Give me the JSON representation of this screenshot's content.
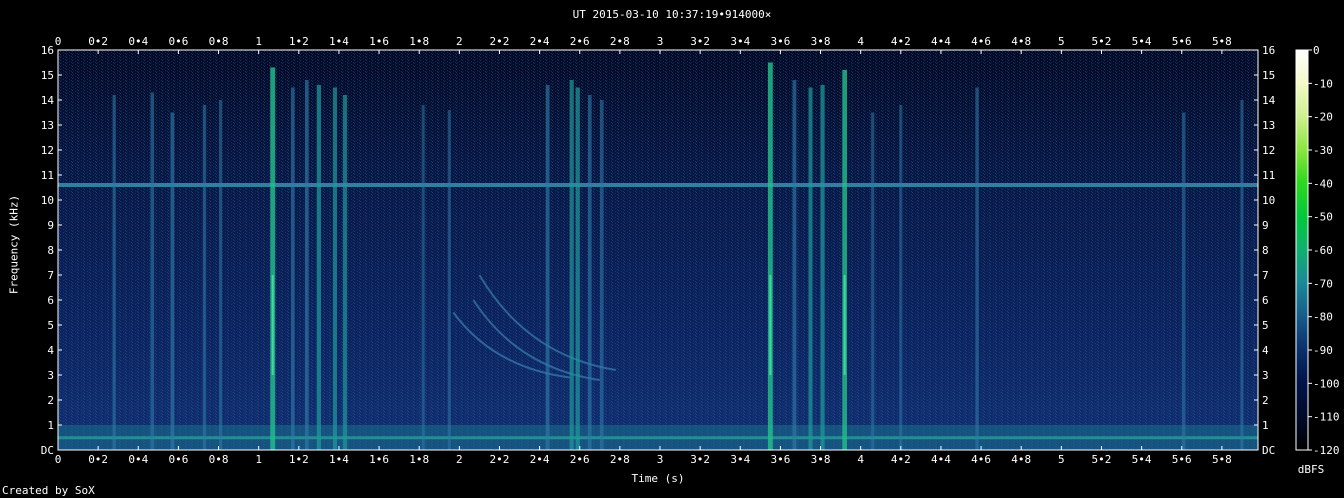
{
  "chart_data": {
    "type": "heatmap",
    "title": "UT 2015-03-10 10:37:19•914000×",
    "xlabel": "Time (s)",
    "ylabel": "Frequency (kHz)",
    "xlim": [
      0,
      5.98
    ],
    "ylim": [
      0,
      16
    ],
    "x_tick_labels": [
      "0",
      "0•2",
      "0•4",
      "0•6",
      "0•8",
      "1",
      "1•2",
      "1•4",
      "1•6",
      "1•8",
      "2",
      "2•2",
      "2•4",
      "2•6",
      "2•8",
      "3",
      "3•2",
      "3•4",
      "3•6",
      "3•8",
      "4",
      "4•2",
      "4•4",
      "4•6",
      "4•8",
      "5",
      "5•2",
      "5•4",
      "5•6",
      "5•8"
    ],
    "y_tick_labels": [
      "DC",
      "1",
      "2",
      "3",
      "4",
      "5",
      "6",
      "7",
      "8",
      "9",
      "10",
      "11",
      "12",
      "13",
      "14",
      "15",
      "16"
    ],
    "colorbar": {
      "label": "dBFS",
      "range": [
        -120,
        0
      ],
      "tick_labels": [
        "0",
        "-10",
        "-20",
        "-30",
        "-40",
        "-50",
        "-60",
        "-70",
        "-80",
        "-90",
        "-100",
        "-110",
        "-120"
      ]
    },
    "features": {
      "tone_khz": 10.6,
      "low_band_khz": [
        0,
        1
      ],
      "clicks": [
        {
          "t": 0.28,
          "top": 14.2,
          "strength": 0.45
        },
        {
          "t": 0.47,
          "top": 14.3,
          "strength": 0.5
        },
        {
          "t": 0.57,
          "top": 13.5,
          "strength": 0.6
        },
        {
          "t": 0.73,
          "top": 13.8,
          "strength": 0.45
        },
        {
          "t": 0.81,
          "top": 14.0,
          "strength": 0.4
        },
        {
          "t": 1.07,
          "top": 15.3,
          "strength": 0.95
        },
        {
          "t": 1.17,
          "top": 14.5,
          "strength": 0.55
        },
        {
          "t": 1.24,
          "top": 14.8,
          "strength": 0.6
        },
        {
          "t": 1.3,
          "top": 14.6,
          "strength": 0.75
        },
        {
          "t": 1.38,
          "top": 14.5,
          "strength": 0.7
        },
        {
          "t": 1.43,
          "top": 14.2,
          "strength": 0.7
        },
        {
          "t": 1.82,
          "top": 13.8,
          "strength": 0.35
        },
        {
          "t": 1.95,
          "top": 13.6,
          "strength": 0.35
        },
        {
          "t": 2.44,
          "top": 14.6,
          "strength": 0.6
        },
        {
          "t": 2.56,
          "top": 14.8,
          "strength": 0.7
        },
        {
          "t": 2.59,
          "top": 14.5,
          "strength": 0.75
        },
        {
          "t": 2.65,
          "top": 14.2,
          "strength": 0.55
        },
        {
          "t": 2.71,
          "top": 14.0,
          "strength": 0.5
        },
        {
          "t": 3.55,
          "top": 15.5,
          "strength": 0.95
        },
        {
          "t": 3.67,
          "top": 14.8,
          "strength": 0.6
        },
        {
          "t": 3.75,
          "top": 14.5,
          "strength": 0.7
        },
        {
          "t": 3.81,
          "top": 14.6,
          "strength": 0.75
        },
        {
          "t": 3.92,
          "top": 15.2,
          "strength": 0.9
        },
        {
          "t": 4.06,
          "top": 13.5,
          "strength": 0.4
        },
        {
          "t": 4.2,
          "top": 13.8,
          "strength": 0.35
        },
        {
          "t": 4.58,
          "top": 14.5,
          "strength": 0.45
        },
        {
          "t": 5.61,
          "top": 13.5,
          "strength": 0.45
        },
        {
          "t": 5.9,
          "top": 14.0,
          "strength": 0.4
        }
      ],
      "chirps": [
        {
          "t0": 1.97,
          "f0": 5.5,
          "t1": 2.55,
          "f1": 2.9
        },
        {
          "t0": 2.07,
          "f0": 6.0,
          "t1": 2.7,
          "f1": 2.8
        },
        {
          "t0": 2.1,
          "f0": 7.0,
          "t1": 2.78,
          "f1": 3.2
        }
      ]
    }
  },
  "footer": {
    "credit": "Created by SoX"
  }
}
